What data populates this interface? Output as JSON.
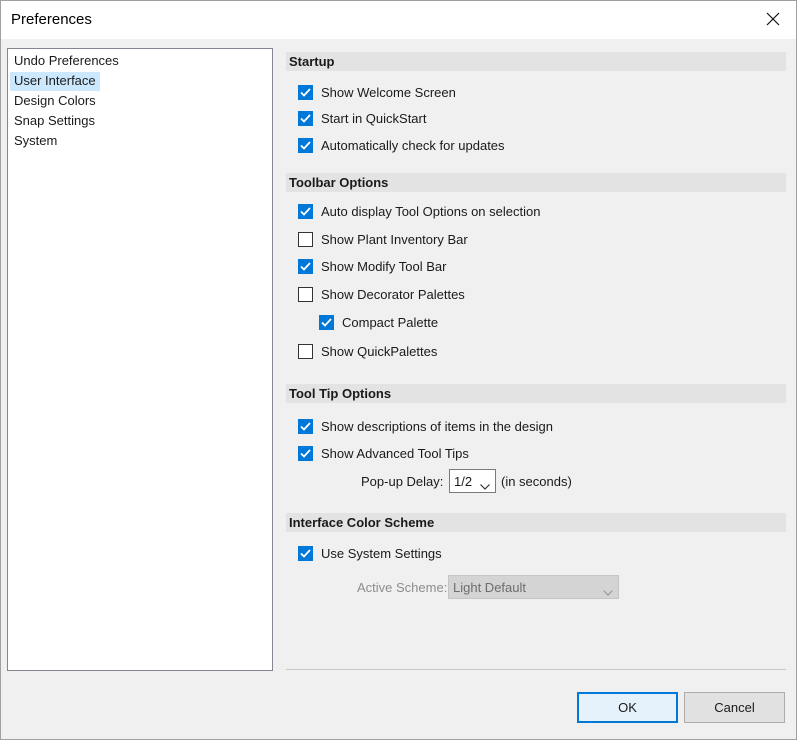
{
  "window": {
    "title": "Preferences"
  },
  "nav": {
    "items": [
      {
        "label": "Undo Preferences",
        "selected": false
      },
      {
        "label": "User Interface",
        "selected": true
      },
      {
        "label": "Design Colors",
        "selected": false
      },
      {
        "label": "Snap Settings",
        "selected": false
      },
      {
        "label": "System",
        "selected": false
      }
    ]
  },
  "startup": {
    "header": "Startup",
    "show_welcome": {
      "label": "Show Welcome Screen",
      "checked": true
    },
    "start_quickstart": {
      "label": "Start in QuickStart",
      "checked": true
    },
    "check_updates": {
      "label": "Automatically check for updates",
      "checked": true
    }
  },
  "toolbar": {
    "header": "Toolbar Options",
    "auto_display": {
      "label": "Auto display Tool Options on selection",
      "checked": true
    },
    "plant_inventory": {
      "label": "Show Plant Inventory Bar",
      "checked": false
    },
    "modify_toolbar": {
      "label": "Show Modify Tool Bar",
      "checked": true
    },
    "decorator_palettes": {
      "label": "Show Decorator Palettes",
      "checked": false
    },
    "compact_palette": {
      "label": "Compact Palette",
      "checked": true
    },
    "quickpalettes": {
      "label": "Show QuickPalettes",
      "checked": false
    }
  },
  "tooltips": {
    "header": "Tool Tip Options",
    "descriptions": {
      "label": "Show descriptions of items in the design",
      "checked": true
    },
    "advanced": {
      "label": "Show Advanced Tool Tips",
      "checked": true
    },
    "popup_delay_label": "Pop-up Delay:",
    "popup_delay_value": "1/2",
    "popup_delay_unit": "(in seconds)"
  },
  "color_scheme": {
    "header": "Interface Color Scheme",
    "use_system": {
      "label": "Use System Settings",
      "checked": true
    },
    "active_scheme_label": "Active Scheme:",
    "active_scheme_value": "Light Default"
  },
  "buttons": {
    "ok": "OK",
    "cancel": "Cancel"
  },
  "colors": {
    "accent": "#0078d7",
    "selection": "#cce8ff",
    "section_bg": "#e3e3e3"
  }
}
